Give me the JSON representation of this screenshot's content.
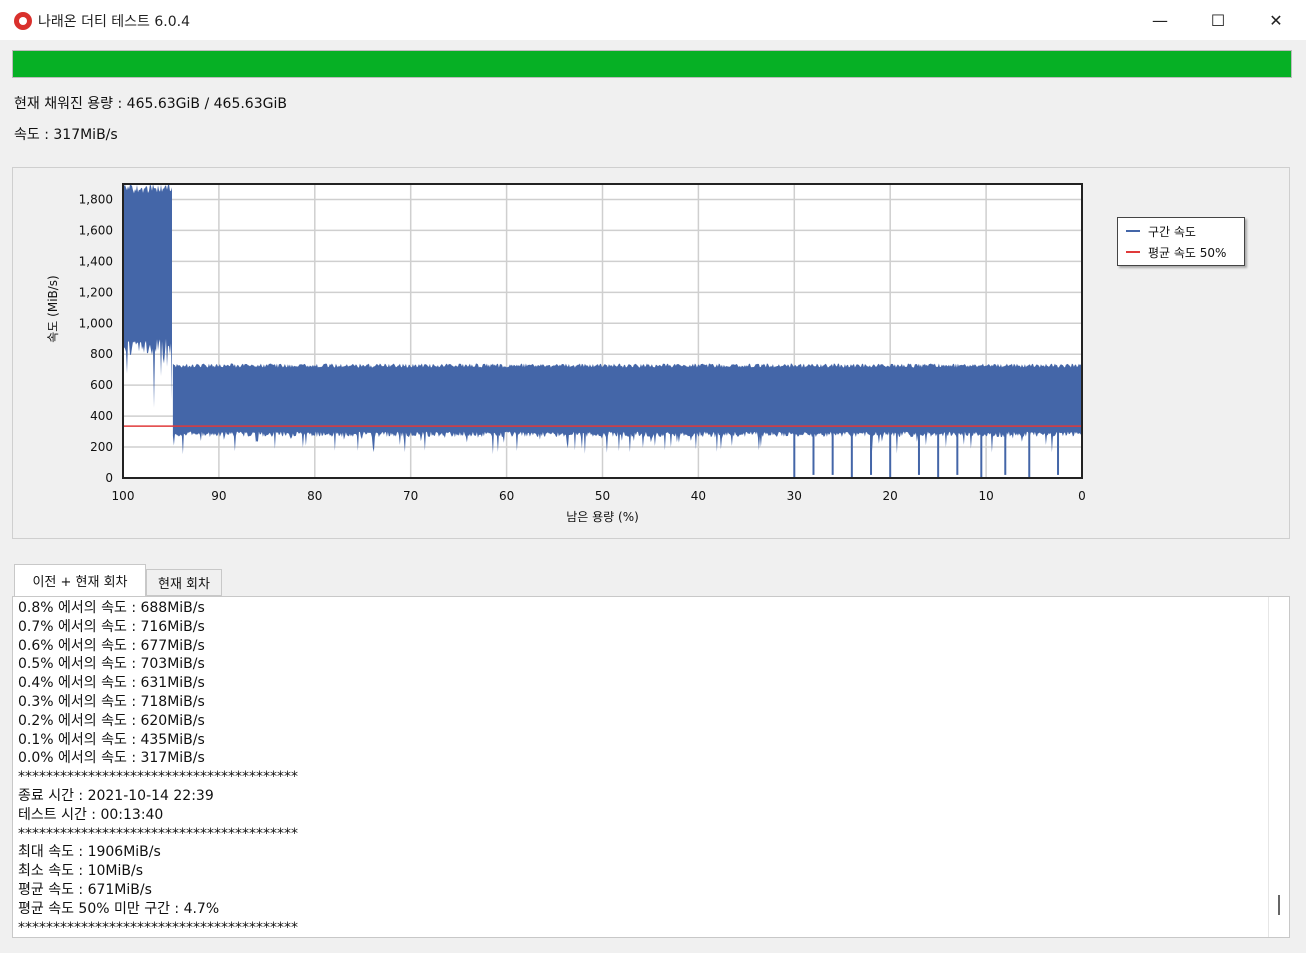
{
  "window": {
    "title": "나래온 더티 테스트 6.0.4",
    "minimize_glyph": "—",
    "maximize_glyph": "☐",
    "close_glyph": "✕"
  },
  "progress": {
    "value": 1.0,
    "color": "#06b025"
  },
  "status": {
    "capacity_line": "현재 채워진 용량 : 465.63GiB / 465.63GiB",
    "speed_line": "속도 : 317MiB/s"
  },
  "legend": {
    "interval_label": "구간 속도",
    "avg_label": "평균 속도 50%"
  },
  "tabs": [
    {
      "label": "이전 + 현재 회차",
      "active": true
    },
    {
      "label": "현재 회차",
      "active": false
    }
  ],
  "log": [
    "0.8% 에서의 속도 : 688MiB/s",
    "0.7% 에서의 속도 : 716MiB/s",
    "0.6% 에서의 속도 : 677MiB/s",
    "0.5% 에서의 속도 : 703MiB/s",
    "0.4% 에서의 속도 : 631MiB/s",
    "0.3% 에서의 속도 : 718MiB/s",
    "0.2% 에서의 속도 : 620MiB/s",
    "0.1% 에서의 속도 : 435MiB/s",
    "0.0% 에서의 속도 : 317MiB/s",
    "****************************************",
    "종료 시간 : 2021-10-14 22:39",
    "테스트 시간 : 00:13:40",
    "****************************************",
    "최대 속도 : 1906MiB/s",
    "최소 속도 : 10MiB/s",
    "평균 속도 : 671MiB/s",
    "평균 속도 50% 미만 구간 : 4.7%",
    "****************************************"
  ],
  "chart_data": {
    "type": "area",
    "xlabel": "남은 용량 (%)",
    "ylabel": "속도 (MiB/s)",
    "xlim": [
      100,
      0
    ],
    "ylim": [
      0,
      1900
    ],
    "xticks": [
      100,
      90,
      80,
      70,
      60,
      50,
      40,
      30,
      20,
      10,
      0
    ],
    "yticks": [
      0,
      200,
      400,
      600,
      800,
      1000,
      1200,
      1400,
      1600,
      1800
    ],
    "ytick_labels": [
      "0",
      "200",
      "400",
      "600",
      "800",
      "1,000",
      "1,200",
      "1,400",
      "1,600",
      "1,800"
    ],
    "grid": true,
    "legend_position": "right",
    "series": [
      {
        "name": "구간 속도",
        "color": "#4466a8",
        "segments": [
          {
            "x_from": 100,
            "x_to": 94.8,
            "y_low": 900,
            "y_high": 1900
          },
          {
            "x_from": 94.8,
            "x_to": 0,
            "y_low": 300,
            "y_high": 740
          }
        ],
        "dips": [
          {
            "x": 30,
            "y": 0
          },
          {
            "x": 28,
            "y": 20
          },
          {
            "x": 26,
            "y": 20
          },
          {
            "x": 24,
            "y": 0
          },
          {
            "x": 22,
            "y": 20
          },
          {
            "x": 20,
            "y": 0
          },
          {
            "x": 17,
            "y": 20
          },
          {
            "x": 15,
            "y": 0
          },
          {
            "x": 13,
            "y": 20
          },
          {
            "x": 10.5,
            "y": 0
          },
          {
            "x": 8,
            "y": 20
          },
          {
            "x": 5.5,
            "y": 0
          },
          {
            "x": 2.5,
            "y": 20
          }
        ]
      },
      {
        "name": "평균 속도 50%",
        "color": "#e03a3a",
        "y": 335
      }
    ]
  }
}
